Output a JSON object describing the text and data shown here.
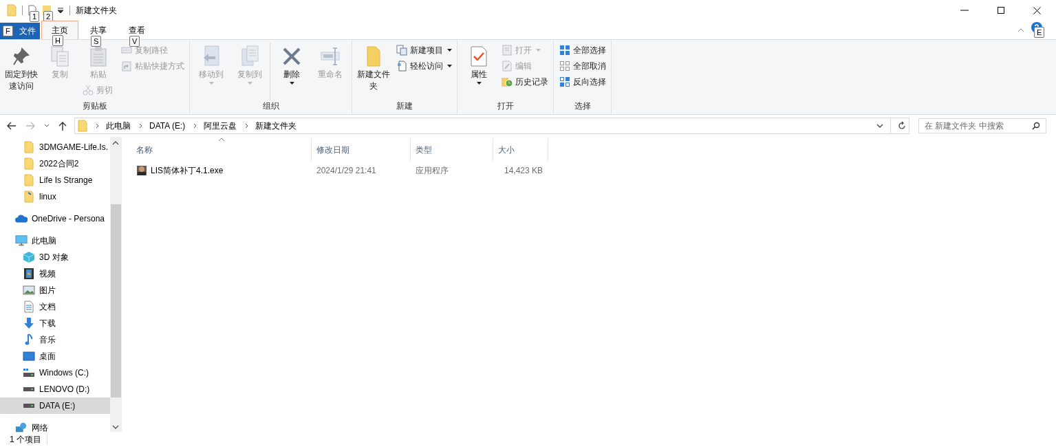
{
  "window": {
    "title": "新建文件夹",
    "quick_access_tips": [
      "1",
      "2"
    ]
  },
  "tabs": [
    {
      "label": "文件",
      "key_tip": "F",
      "selected": false,
      "kind": "file"
    },
    {
      "label": "主页",
      "key_tip": "H",
      "selected": true,
      "kind": "tab"
    },
    {
      "label": "共享",
      "key_tip": "S",
      "selected": false,
      "kind": "tab"
    },
    {
      "label": "查看",
      "key_tip": "V",
      "selected": false,
      "kind": "tab"
    }
  ],
  "help_key_tip": "E",
  "ribbon": [
    {
      "label": "剪贴板",
      "columns": [
        [
          {
            "label": "固定到快速访问",
            "kind": "large",
            "disabled": false,
            "dropdown": false
          }
        ],
        [
          {
            "label": "复制",
            "kind": "large",
            "disabled": true,
            "dropdown": false
          }
        ],
        [
          {
            "label": "粘贴",
            "kind": "large",
            "disabled": true,
            "dropdown": false
          },
          {
            "label": "剪切",
            "kind": "small",
            "disabled": true,
            "dropdown": false
          }
        ],
        [
          {
            "label": "复制路径",
            "kind": "small",
            "disabled": true,
            "dropdown": false
          },
          {
            "label": "粘贴快捷方式",
            "kind": "small",
            "disabled": true,
            "dropdown": false
          }
        ]
      ]
    },
    {
      "label": "组织",
      "columns": [
        [
          {
            "label": "移动到",
            "kind": "large",
            "disabled": true,
            "dropdown": true
          }
        ],
        [
          {
            "label": "复制到",
            "kind": "large",
            "disabled": true,
            "dropdown": true
          }
        ],
        [
          {
            "label": "删除",
            "kind": "large",
            "disabled": false,
            "dropdown": true
          }
        ],
        [
          {
            "label": "重命名",
            "kind": "large",
            "disabled": true,
            "dropdown": false
          }
        ]
      ]
    },
    {
      "label": "新建",
      "columns": [
        [
          {
            "label": "新建文件夹",
            "kind": "large",
            "disabled": false,
            "dropdown": false
          }
        ],
        [
          {
            "label": "新建项目",
            "kind": "small",
            "disabled": false,
            "dropdown": true
          },
          {
            "label": "轻松访问",
            "kind": "small",
            "disabled": false,
            "dropdown": true
          }
        ]
      ]
    },
    {
      "label": "打开",
      "columns": [
        [
          {
            "label": "属性",
            "kind": "large",
            "disabled": false,
            "dropdown": true
          }
        ],
        [
          {
            "label": "打开",
            "kind": "small",
            "disabled": true,
            "dropdown": true
          },
          {
            "label": "编辑",
            "kind": "small",
            "disabled": true,
            "dropdown": false
          },
          {
            "label": "历史记录",
            "kind": "small",
            "disabled": false,
            "dropdown": false
          }
        ]
      ]
    },
    {
      "label": "选择",
      "columns": [
        [
          {
            "label": "全部选择",
            "kind": "small",
            "disabled": false,
            "dropdown": false
          },
          {
            "label": "全部取消",
            "kind": "small",
            "disabled": false,
            "dropdown": false
          },
          {
            "label": "反向选择",
            "kind": "small",
            "disabled": false,
            "dropdown": false
          }
        ]
      ]
    }
  ],
  "address_bar": {
    "path": [
      "此电脑",
      "DATA (E:)",
      "阿里云盘",
      "新建文件夹"
    ]
  },
  "search": {
    "placeholder": "在 新建文件夹 中搜索"
  },
  "navigation": {
    "quick_access": [
      {
        "label": "3DMGAME-Life.Is.",
        "selected": false
      },
      {
        "label": "2022合同2",
        "selected": false
      },
      {
        "label": "Life Is Strange",
        "selected": false
      },
      {
        "label": "linux",
        "selected": false
      }
    ],
    "onedrive": {
      "label": "OneDrive - Persona",
      "selected": false
    },
    "this_pc": {
      "label": "此电脑",
      "selected": false,
      "children": [
        {
          "label": "3D 对象",
          "selected": false
        },
        {
          "label": "视频",
          "selected": false
        },
        {
          "label": "图片",
          "selected": false
        },
        {
          "label": "文档",
          "selected": false
        },
        {
          "label": "下载",
          "selected": false
        },
        {
          "label": "音乐",
          "selected": false
        },
        {
          "label": "桌面",
          "selected": false
        },
        {
          "label": "Windows (C:)",
          "selected": false
        },
        {
          "label": "LENOVO (D:)",
          "selected": false
        },
        {
          "label": "DATA (E:)",
          "selected": true
        }
      ]
    },
    "network": {
      "label": "网络",
      "selected": false
    }
  },
  "file_list": {
    "columns": [
      "名称",
      "修改日期",
      "类型",
      "大小"
    ],
    "rows": [
      {
        "name": "LIS简体补丁4.1.exe",
        "modified": "2024/1/29 21:41",
        "type": "应用程序",
        "size": "14,423 KB",
        "selected": false
      }
    ]
  },
  "status_bar": {
    "item_count": "1 个项目"
  }
}
